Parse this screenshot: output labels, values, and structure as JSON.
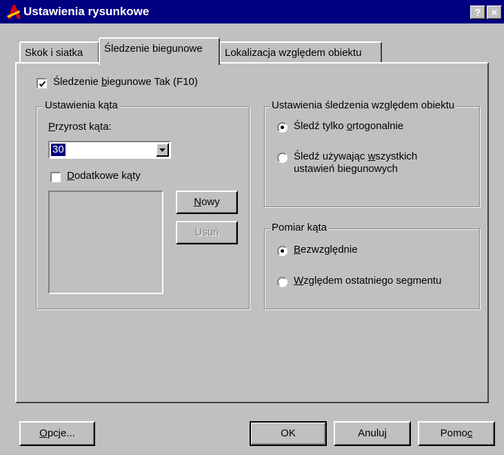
{
  "window": {
    "title": "Ustawienia rysunkowe",
    "help_button": "?",
    "close_button": "×"
  },
  "tabs": [
    {
      "label": "Skok i siatka",
      "active": false
    },
    {
      "label": "Śledzenie biegunowe",
      "active": true
    },
    {
      "label": "Lokalizacja względem obiektu",
      "active": false
    }
  ],
  "polar_tracking": {
    "pre": "Śledzenie ",
    "accel": "b",
    "post": "iegunowe Tak (F10)",
    "checked": true
  },
  "angle_settings": {
    "legend": "Ustawienia kąta",
    "increment_accel": "P",
    "increment_rest": "rzyrost kąta:",
    "increment_value": "30",
    "additional_accel": "D",
    "additional_rest": "odatkowe kąty",
    "additional_checked": false,
    "new_accel": "N",
    "new_rest": "owy",
    "delete_label": "Usuń"
  },
  "object_tracking": {
    "legend": "Ustawienia śledzenia względem obiektu",
    "ortho_pre": "Śledź tylko ",
    "ortho_accel": "o",
    "ortho_post": "rtogonalnie",
    "all_line1_pre": "Śledź używając ",
    "all_line1_accel": "w",
    "all_line1_post": "szystkich",
    "all_line2": "ustawień biegunowych",
    "selected": "ortho"
  },
  "angle_measure": {
    "legend": "Pomiar kąta",
    "abs_accel": "B",
    "abs_rest": "ezwzględnie",
    "rel_accel": "W",
    "rel_rest": "zględem ostatniego segmentu",
    "selected": "absolute"
  },
  "footer": {
    "options_accel": "O",
    "options_rest": "pcje...",
    "ok": "OK",
    "cancel": "Anuluj",
    "help_pre": "Pomo",
    "help_accel": "c"
  }
}
